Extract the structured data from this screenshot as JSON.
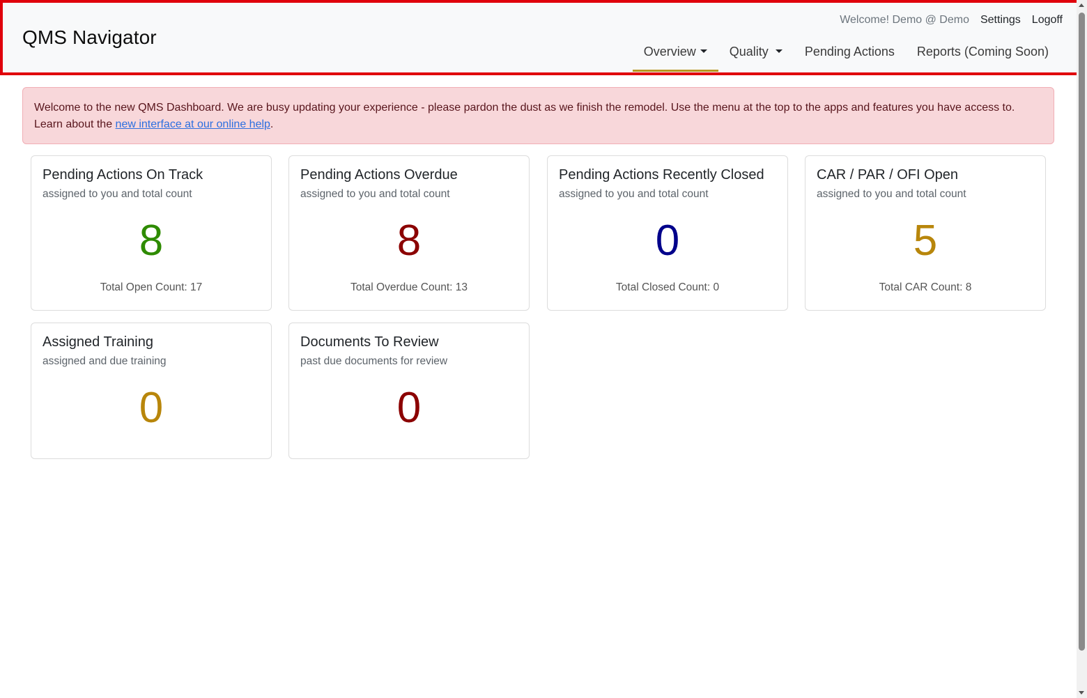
{
  "header": {
    "brand": "QMS Navigator",
    "welcome": "Welcome! Demo @ Demo",
    "settings_label": "Settings",
    "logoff_label": "Logoff",
    "nav": {
      "overview": "Overview",
      "quality": "Quality",
      "pending_actions": "Pending Actions",
      "reports": "Reports (Coming Soon)"
    },
    "active_tab": "Overview",
    "highlight_color": "#e0000b",
    "active_underline_color": "#b8961e"
  },
  "alert": {
    "text_before": "Welcome to the new QMS Dashboard. We are busy updating your experience - please pardon the dust as we finish the remodel. Use the menu at the top to the apps and features you have access to. Learn about the ",
    "link_text": "new interface at our online help",
    "text_after": "."
  },
  "cards": {
    "on_track": {
      "title": "Pending Actions On Track",
      "subtitle": "assigned to you and total count",
      "count": "8",
      "footer": "Total Open Count: 17",
      "color": "#2e8b00"
    },
    "overdue": {
      "title": "Pending Actions Overdue",
      "subtitle": "assigned to you and total count",
      "count": "8",
      "footer": "Total Overdue Count: 13",
      "color": "#8b0000"
    },
    "recently_closed": {
      "title": "Pending Actions Recently Closed",
      "subtitle": "assigned to you and total count",
      "count": "0",
      "footer": "Total Closed Count: 0",
      "color": "#00008b"
    },
    "car_par_ofi": {
      "title": "CAR / PAR / OFI Open",
      "subtitle": "assigned to you and total count",
      "count": "5",
      "footer": "Total CAR Count: 8",
      "color": "#b8860b"
    },
    "training": {
      "title": "Assigned Training",
      "subtitle": "assigned and due training",
      "count": "0",
      "color": "#b8860b"
    },
    "documents": {
      "title": "Documents To Review",
      "subtitle": "past due documents for review",
      "count": "0",
      "color": "#8b0000"
    }
  }
}
